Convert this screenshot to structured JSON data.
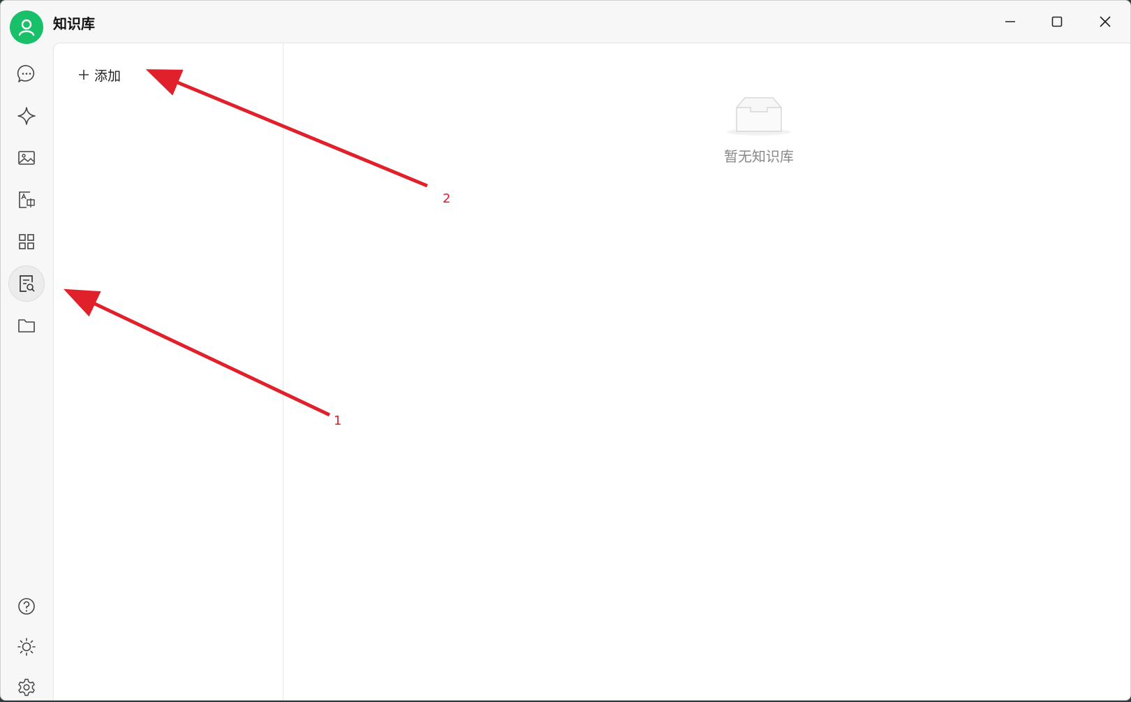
{
  "window": {
    "title": "知识库",
    "controls": {
      "minimize": "minimize-icon",
      "maximize": "maximize-icon",
      "close": "close-icon"
    }
  },
  "rail": {
    "items": [
      {
        "name": "chat",
        "icon": "chat-bubble-icon"
      },
      {
        "name": "assistant",
        "icon": "sparkle-icon"
      },
      {
        "name": "image",
        "icon": "image-icon"
      },
      {
        "name": "translate",
        "icon": "translate-icon"
      },
      {
        "name": "apps",
        "icon": "grid-icon"
      },
      {
        "name": "knowledge",
        "icon": "knowledge-search-icon",
        "active": true
      },
      {
        "name": "files",
        "icon": "folder-icon"
      }
    ],
    "bottom": [
      {
        "name": "help",
        "icon": "help-icon"
      },
      {
        "name": "theme",
        "icon": "sun-icon"
      },
      {
        "name": "settings",
        "icon": "gear-icon"
      }
    ]
  },
  "knowledge": {
    "add_label": "添加",
    "empty_text": "暂无知识库"
  },
  "annotations": {
    "labels": [
      "1",
      "2"
    ],
    "color": "#e0202a"
  },
  "colors": {
    "brand": "#19c06a"
  }
}
